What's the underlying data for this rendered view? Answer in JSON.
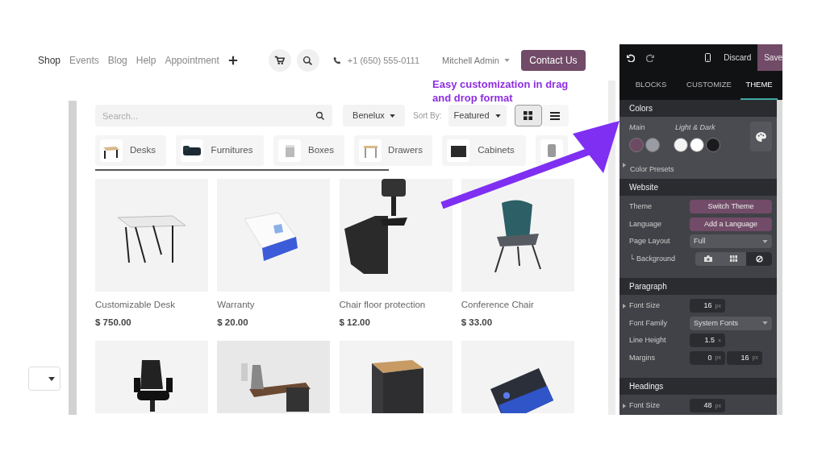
{
  "nav": {
    "items": [
      {
        "label": "Shop",
        "selected": true
      },
      {
        "label": "Events",
        "selected": false
      },
      {
        "label": "Blog",
        "selected": false
      },
      {
        "label": "Help",
        "selected": false
      },
      {
        "label": "Appointment",
        "selected": false
      }
    ],
    "phone": "+1 (650) 555-0111",
    "user": "Mitchell Admin",
    "contact": "Contact Us"
  },
  "filters": {
    "search": {
      "placeholder": "Search..."
    },
    "pricelist": "Benelux",
    "sort_label": "Sort By:",
    "sort": "Featured",
    "views": [
      {
        "kind": "grid",
        "selected": true
      },
      {
        "kind": "list",
        "selected": false
      }
    ]
  },
  "categories": [
    {
      "kind": "chip",
      "label": "Desks"
    },
    {
      "kind": "chip",
      "label": "Furnitures"
    },
    {
      "kind": "chip",
      "label": "Boxes"
    },
    {
      "kind": "chip",
      "label": "Drawers"
    },
    {
      "kind": "chip",
      "label": "Cabinets"
    },
    {
      "kind": "partial"
    }
  ],
  "products": [
    {
      "kind": "product",
      "name": "Customizable Desk",
      "price": "$ 750.00"
    },
    {
      "kind": "product",
      "name": "Warranty",
      "price": "$ 20.00"
    },
    {
      "kind": "product",
      "name": "Chair floor protection",
      "price": "$ 12.00"
    },
    {
      "kind": "product",
      "name": "Conference Chair",
      "price": "$ 33.00"
    },
    {
      "kind": "picture"
    },
    {
      "kind": "picture"
    },
    {
      "kind": "picture"
    },
    {
      "kind": "picture"
    }
  ],
  "annotation": "Easy customization in drag and drop format",
  "editor": {
    "discard": "Discard",
    "save": "Save",
    "tabs": [
      {
        "label": "BLOCKS",
        "selected": false
      },
      {
        "label": "CUSTOMIZE",
        "selected": false
      },
      {
        "label": "THEME",
        "selected": true
      }
    ],
    "colors": {
      "title": "Colors",
      "main_label": "Main",
      "light_dark_label": "Light & Dark",
      "main": [
        {
          "color": "#6d4a64"
        },
        {
          "color": "#9a9ca3"
        }
      ],
      "light_dark": [
        {
          "color": "#f4f4f4"
        },
        {
          "color": "#ffffff"
        },
        {
          "color": "#1b1b1d"
        }
      ],
      "presets": {
        "label": "Color Presets",
        "expanded": false
      }
    },
    "sections": [
      {
        "title": "Website",
        "rows": [
          {
            "kind": "button",
            "label": "Theme",
            "value": "Switch Theme"
          },
          {
            "kind": "button",
            "label": "Language",
            "value": "Add a Language"
          },
          {
            "kind": "select",
            "label": "Page Layout",
            "value": "Full"
          },
          {
            "kind": "segmented",
            "label": "└ Background",
            "options": [
              {
                "kind": "camera",
                "selected": false
              },
              {
                "kind": "grid",
                "selected": false
              },
              {
                "kind": "none",
                "selected": true
              }
            ]
          }
        ]
      },
      {
        "title": "Paragraph",
        "rows": [
          {
            "kind": "number",
            "label": "Font Size",
            "expanded": false,
            "values": [
              {
                "value": "16",
                "unit": "px"
              }
            ]
          },
          {
            "kind": "select",
            "label": "Font Family",
            "value": "System Fonts"
          },
          {
            "kind": "number",
            "label": "Line Height",
            "values": [
              {
                "value": "1.5",
                "unit": "×"
              }
            ]
          },
          {
            "kind": "number",
            "label": "Margins",
            "values": [
              {
                "value": "0",
                "unit": "px"
              },
              {
                "value": "16",
                "unit": "px"
              }
            ]
          }
        ]
      },
      {
        "title": "Headings",
        "rows": [
          {
            "kind": "number",
            "label": "Font Size",
            "expanded": false,
            "values": [
              {
                "value": "48",
                "unit": "px"
              }
            ]
          }
        ]
      }
    ]
  }
}
